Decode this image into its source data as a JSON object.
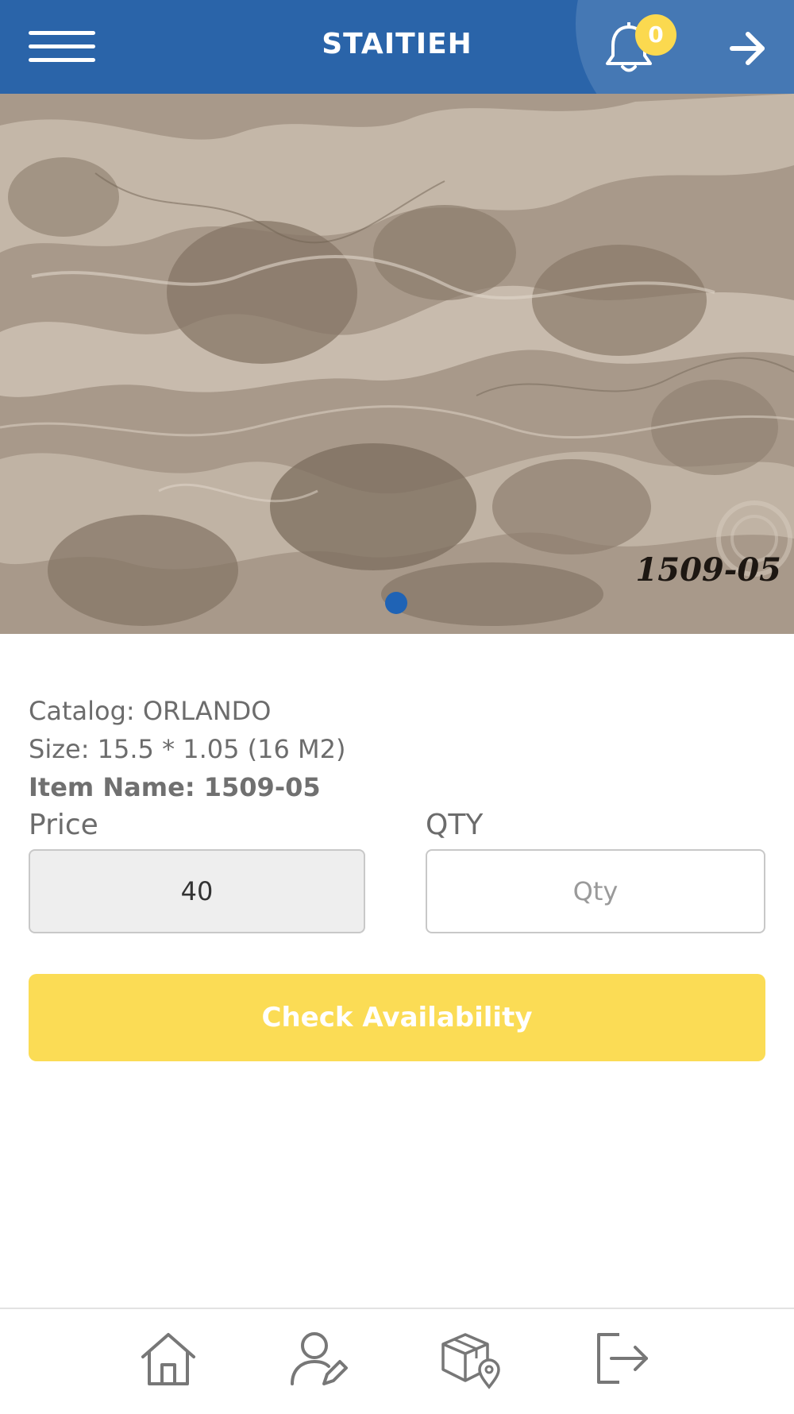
{
  "header": {
    "title": "STAITIEH",
    "notification_count": "0",
    "menu_icon": "hamburger-menu-icon",
    "notification_icon": "bell-icon",
    "forward_icon": "arrow-right-icon"
  },
  "product_image": {
    "code_label": "1509-05",
    "carousel_dots": 1,
    "active_dot": 0
  },
  "product": {
    "catalog": "Catalog: ORLANDO",
    "size": "Size: 15.5 * 1.05 (16 M2)",
    "item_name": "Item Name: 1509-05"
  },
  "form": {
    "price_label": "Price",
    "price_value": "40",
    "qty_label": "QTY",
    "qty_placeholder": "Qty",
    "qty_value": ""
  },
  "actions": {
    "check_availability": "Check Availability"
  },
  "bottom_nav": {
    "items": [
      {
        "icon": "home-icon"
      },
      {
        "icon": "user-edit-icon"
      },
      {
        "icon": "package-location-icon"
      },
      {
        "icon": "logout-icon"
      }
    ]
  },
  "colors": {
    "header_bg": "#2a64a9",
    "accent_yellow": "#fbdc55",
    "dot_blue": "#1f63b5"
  }
}
